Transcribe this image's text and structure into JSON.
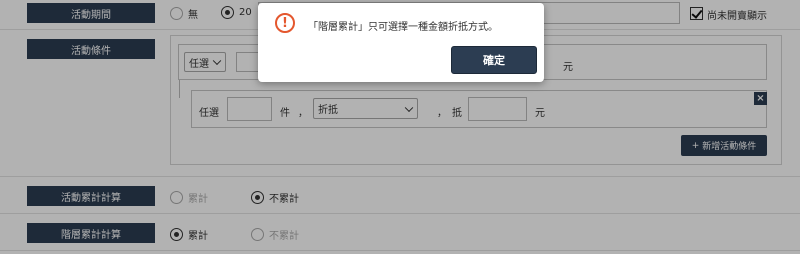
{
  "period": {
    "label": "活動期間",
    "option_none": "無",
    "date_prefix": "20",
    "unpublished_show_label": "尚未開賣顯示"
  },
  "condition": {
    "label": "活動條件",
    "top_select": "任選",
    "top_unit": "元",
    "rule": {
      "prefix": "任選",
      "unit_items": "件",
      "comma1": "，",
      "discount_type": "折抵",
      "comma2": "，",
      "deduct_label": "抵",
      "unit_money": "元"
    },
    "remove_icon": "×",
    "add_button_label": "新增活動條件",
    "add_button_icon": "+"
  },
  "activity_cumulative": {
    "label": "活動累計計算",
    "option_cumulative": "累計",
    "option_not_cumulative": "不累計",
    "selected": "不累計"
  },
  "tier_cumulative": {
    "label": "階層累計計算",
    "option_cumulative": "累計",
    "option_not_cumulative": "不累計",
    "selected": "累計"
  },
  "dialog": {
    "icon": "warning-icon",
    "icon_glyph": "!",
    "message": "「階層累計」只可選擇一種金額折抵方式。",
    "ok_label": "確定",
    "accent_color": "#e4572e",
    "button_color": "#2c3d52"
  }
}
